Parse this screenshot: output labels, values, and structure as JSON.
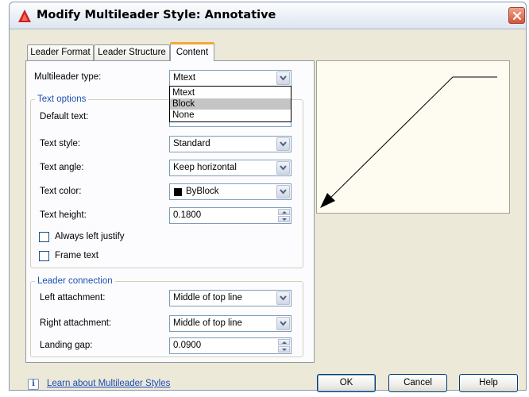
{
  "window": {
    "title": "Modify Multileader Style: Annotative"
  },
  "tabs": [
    {
      "label": "Leader Format"
    },
    {
      "label": "Leader Structure"
    },
    {
      "label": "Content"
    }
  ],
  "multileader_type": {
    "label": "Multileader type:",
    "value": "Mtext",
    "options": [
      "Mtext",
      "Block",
      "None"
    ],
    "highlighted_option": "Block"
  },
  "text_options": {
    "title": "Text options",
    "default_text_label": "Default text:",
    "text_style": {
      "label": "Text style:",
      "value": "Standard"
    },
    "text_angle": {
      "label": "Text angle:",
      "value": "Keep horizontal"
    },
    "text_color": {
      "label": "Text color:",
      "value": "ByBlock",
      "swatch": "#000000"
    },
    "text_height": {
      "label": "Text height:",
      "value": "0.1800"
    },
    "always_left_justify": {
      "label": "Always left justify",
      "checked": false
    },
    "frame_text": {
      "label": "Frame text",
      "checked": false
    }
  },
  "leader_connection": {
    "title": "Leader connection",
    "left_attachment": {
      "label": "Left attachment:",
      "value": "Middle of top line"
    },
    "right_attachment": {
      "label": "Right attachment:",
      "value": "Middle of top line"
    },
    "landing_gap": {
      "label": "Landing gap:",
      "value": "0.0900"
    }
  },
  "footer": {
    "info_icon": "info-icon",
    "info_glyph": "i",
    "link": "Learn about Multileader Styles",
    "ok": "OK",
    "cancel": "Cancel",
    "help": "Help"
  },
  "colors": {
    "accent_tab": "#f3a73c",
    "group_title": "#1e50b4",
    "link": "#1c4ab8",
    "preview_bg": "#fefcf0"
  }
}
